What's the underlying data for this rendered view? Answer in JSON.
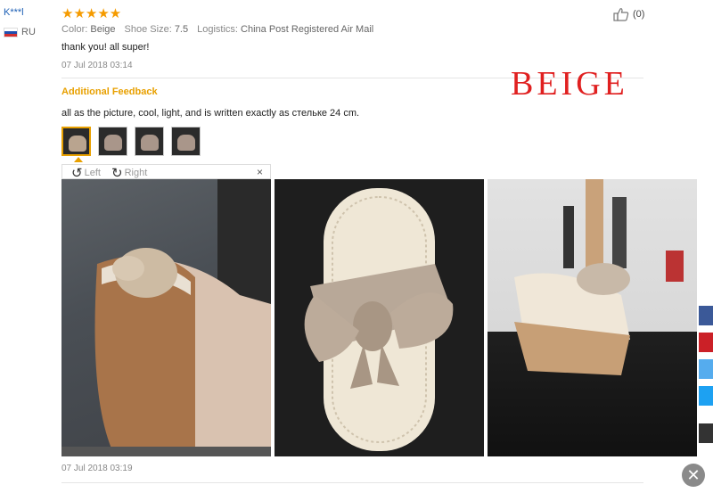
{
  "review": {
    "user": "K***l",
    "country": "RU",
    "rating_stars": 5,
    "stars_text": "★★★★★",
    "color_label": "Color:",
    "color_value": "Beige",
    "size_label": "Shoe Size:",
    "size_value": "7.5",
    "logistics_label": "Logistics:",
    "logistics_value": "China Post Registered Air Mail",
    "like_count": "(0)",
    "text": "thank you! all super!",
    "date": "07 Jul 2018 03:14"
  },
  "additional": {
    "heading": "Additional Feedback",
    "text": "all as the picture, cool, light, and is written exactly as стельке 24 cm.",
    "date": "07 Jul 2018 03:19"
  },
  "overlay_text": "BEIGE",
  "viewer": {
    "left_label": "Left",
    "right_label": "Right",
    "close_symbol": "×"
  },
  "colors": {
    "accent": "#e8a000",
    "star": "#f59b00",
    "beige_label": "#e02020",
    "link": "#1c5fb5"
  },
  "social_colors": [
    "#3b5998",
    "#cb2027",
    "#55acee",
    "#1da1f2",
    "#333333"
  ]
}
